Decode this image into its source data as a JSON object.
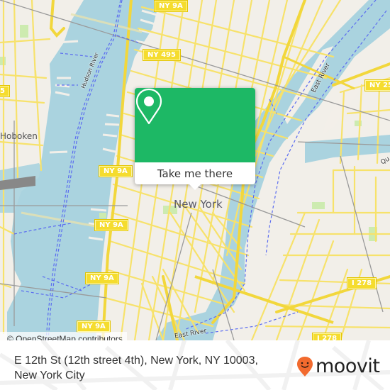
{
  "map": {
    "colors": {
      "water": "#aad3df",
      "land": "#f2efe9",
      "road": "#f7e26b",
      "road_casing": "#e0c64a",
      "rail": "#999999",
      "ferry": "#5b6cf0",
      "park": "#cdebb0"
    },
    "shields": [
      {
        "label": "NY 9A"
      },
      {
        "label": "NY 495"
      },
      {
        "label": "NY 25"
      },
      {
        "label": "NY 9A"
      },
      {
        "label": "NY 9A"
      },
      {
        "label": "NY 9A"
      },
      {
        "label": "NY 9A"
      },
      {
        "label": "I 278"
      },
      {
        "label": "I 278"
      },
      {
        "label": "5"
      }
    ],
    "places": {
      "hoboken": "Hoboken",
      "new_york": "New York"
    },
    "rivers": {
      "hudson": "Hudson River",
      "east_top": "East River",
      "east_bottom": "East River",
      "queens": "Qu"
    },
    "attribution": "© OpenStreetMap contributors"
  },
  "popup": {
    "icon": "location-pin-icon",
    "cta_label": "Take me there",
    "color": "#1db865"
  },
  "footer": {
    "address_line1": "E 12th St (12th street 4th), New York, NY 10003,",
    "address_line2": "New York City",
    "brand": "moovit",
    "brand_color": "#f26a2e"
  }
}
